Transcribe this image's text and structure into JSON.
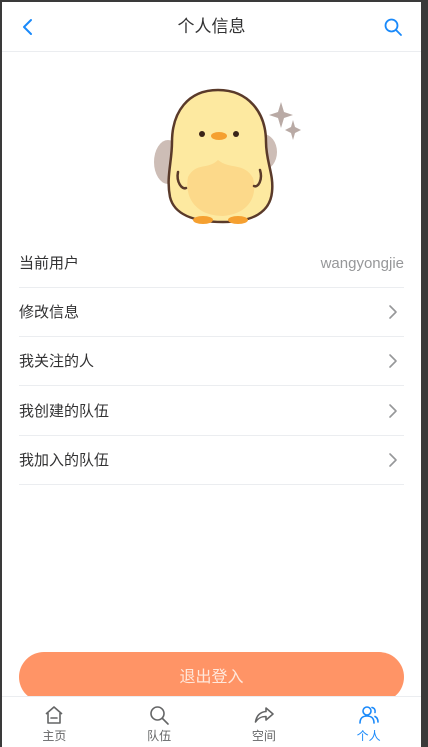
{
  "navbar": {
    "title": "个人信息"
  },
  "profile": {
    "current_user_label": "当前用户",
    "username": "wangyongjie"
  },
  "menu": [
    {
      "label": "修改信息"
    },
    {
      "label": "我关注的人"
    },
    {
      "label": "我创建的队伍"
    },
    {
      "label": "我加入的队伍"
    }
  ],
  "logout_label": "退出登入",
  "tabbar": [
    {
      "label": "主页",
      "icon": "home-icon"
    },
    {
      "label": "队伍",
      "icon": "search-icon"
    },
    {
      "label": "空间",
      "icon": "share-icon"
    },
    {
      "label": "个人",
      "icon": "user-icon",
      "active": true
    }
  ],
  "colors": {
    "accent": "#1989fa",
    "logout": "#ff9466",
    "divider": "#ebedf0"
  }
}
